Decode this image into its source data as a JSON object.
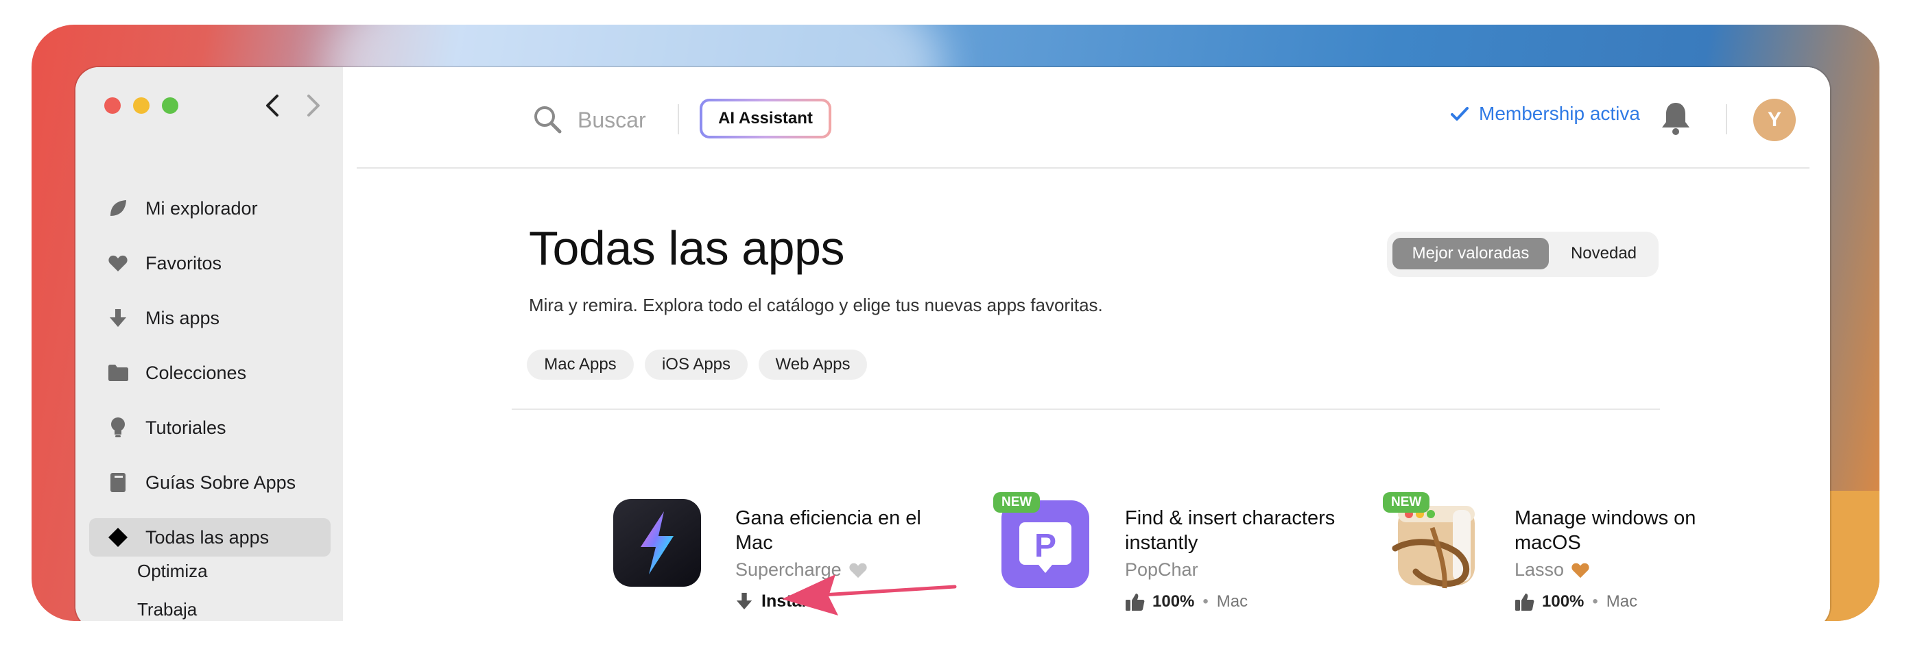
{
  "search": {
    "placeholder": "Buscar"
  },
  "header": {
    "ai_button": "AI Assistant",
    "membership": "Membership activa",
    "avatar_initial": "Y"
  },
  "sidebar": {
    "items": [
      {
        "label": "Mi explorador",
        "icon": "leaf-icon"
      },
      {
        "label": "Favoritos",
        "icon": "heart-icon"
      },
      {
        "label": "Mis apps",
        "icon": "download-arrow-icon"
      },
      {
        "label": "Colecciones",
        "icon": "folder-icon"
      },
      {
        "label": "Tutoriales",
        "icon": "lightbulb-icon"
      },
      {
        "label": "Guías Sobre Apps",
        "icon": "book-icon"
      },
      {
        "label": "Todas las apps",
        "icon": "diamond-icon",
        "active": true
      }
    ],
    "subitems": [
      "Optimiza",
      "Trabaja"
    ]
  },
  "page": {
    "title": "Todas las apps",
    "subtitle": "Mira y remira. Explora todo el catálogo y elige tus nuevas apps favoritas.",
    "sort_options": [
      "Mejor valoradas",
      "Novedad"
    ],
    "sort_selected": "Mejor valoradas",
    "filters": [
      "Mac Apps",
      "iOS Apps",
      "Web Apps"
    ]
  },
  "apps": [
    {
      "title": "Gana eficiencia en el Mac",
      "developer": "Supercharge",
      "heart_color": "#c8c8c8",
      "action": "Instalar",
      "is_new": false
    },
    {
      "title": "Find & insert characters instantly",
      "developer": "PopChar",
      "rating": "100%",
      "platform": "Mac",
      "is_new": true,
      "badge": "NEW"
    },
    {
      "title": "Manage windows on macOS",
      "developer": "Lasso",
      "heart_color": "#d98d3e",
      "rating": "100%",
      "platform": "Mac",
      "is_new": true,
      "badge": "NEW"
    }
  ],
  "colors": {
    "accent": "#2f7ae5",
    "annotation_arrow": "#e84a6f",
    "new_badge": "#5dbb4c"
  }
}
